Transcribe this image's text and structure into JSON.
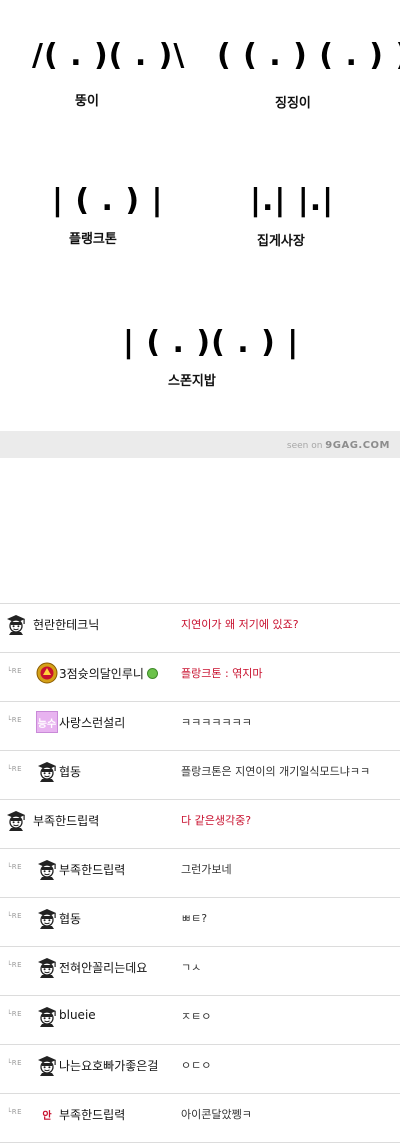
{
  "meme": {
    "faces": [
      {
        "art": "/( . )( . )\\",
        "caption": "뚱이"
      },
      {
        "art": "( ( . ) ( . ) )",
        "caption": "징징이"
      },
      {
        "art": "| ( . ) |",
        "caption": "플랭크톤"
      },
      {
        "art": "|.| |.|",
        "caption": "집게사장"
      },
      {
        "art": "| ( . )( . ) |",
        "caption": "스폰지밥"
      }
    ],
    "footer": {
      "seen_on": "seen on ",
      "site": "9GAG.COM"
    }
  },
  "comments": [
    {
      "type": "top",
      "user": "현란한테크닉",
      "text": "지연이가 왜 저기에 있죠?",
      "red": true,
      "avatar": "graduate-avatar"
    },
    {
      "type": "reply",
      "user": "3점슛의달인루니",
      "text": "플랑크톤 : 엮지마",
      "red": true,
      "avatar": "club-emblem-avatar",
      "online": true
    },
    {
      "type": "reply",
      "user": "사랑스런설리",
      "text": "ㅋㅋㅋㅋㅋㅋㅋ",
      "red": false,
      "avatar": "pink-tile-avatar",
      "avatar_text": "능수"
    },
    {
      "type": "reply",
      "user": "협동",
      "text": "플랑크톤은 지연이의 개기일식모드냐ㅋㅋ",
      "red": false,
      "avatar": "graduate-avatar"
    },
    {
      "type": "top",
      "user": "부족한드립력",
      "text": "다 같은생각중?",
      "red": true,
      "avatar": "graduate-avatar"
    },
    {
      "type": "reply",
      "user": "부족한드립력",
      "text": "그런가보네",
      "red": false,
      "avatar": "graduate-avatar"
    },
    {
      "type": "reply",
      "user": "협동",
      "text": "ㅃㅌ?",
      "red": false,
      "avatar": "graduate-avatar"
    },
    {
      "type": "reply",
      "user": "전혀안꼴리는데요",
      "text": "ㄱㅅ",
      "red": false,
      "avatar": "graduate-avatar"
    },
    {
      "type": "reply",
      "user": "blueie",
      "text": "ㅈㅌㅇ",
      "red": false,
      "avatar": "graduate-avatar"
    },
    {
      "type": "reply",
      "user": "나는요호빠가좋은걸",
      "text": "ㅇㄷㅇ",
      "red": false,
      "avatar": "graduate-avatar"
    },
    {
      "type": "reply",
      "user": "부족한드립력",
      "text": "아이콘달았쩽ㅋ",
      "red": false,
      "avatar": "an-character-avatar",
      "avatar_text": "안"
    }
  ],
  "reply_marker": "└RE",
  "colors": {
    "red_text": "#c8102e",
    "footer_bg": "#ebebeb",
    "row_border": "#dcdcdc"
  }
}
